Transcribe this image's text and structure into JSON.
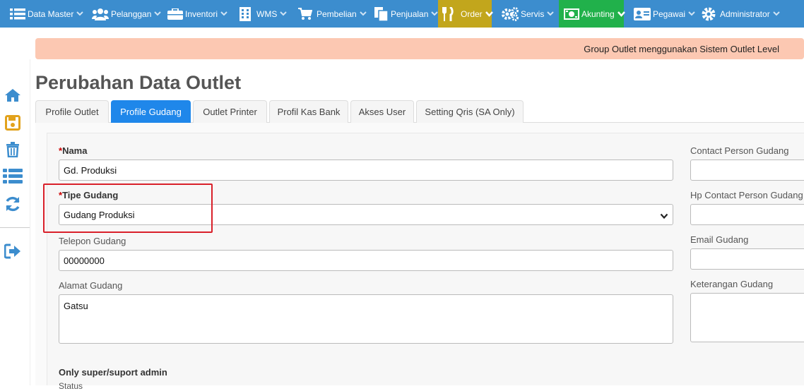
{
  "nav": {
    "items": [
      {
        "label": "Data Master",
        "icon": "list-icon"
      },
      {
        "label": "Pelanggan",
        "icon": "users-icon"
      },
      {
        "label": "Inventori",
        "icon": "briefcase-icon"
      },
      {
        "label": "WMS",
        "icon": "building-icon"
      },
      {
        "label": "Pembelian",
        "icon": "cart-icon"
      },
      {
        "label": "Penjualan",
        "icon": "documents-icon"
      },
      {
        "label": "Order",
        "icon": "utensils-icon"
      },
      {
        "label": "Servis",
        "icon": "gears-icon"
      },
      {
        "label": "Akunting",
        "icon": "money-icon"
      },
      {
        "label": "Pegawai",
        "icon": "id-card-icon"
      },
      {
        "label": "Administrator",
        "icon": "cog-icon"
      }
    ],
    "colors": {
      "bar": "#3c8dce",
      "order": "#c2a61c",
      "akunting": "#21b14b"
    }
  },
  "notice": {
    "text": "Group Outlet menggunakan Sistem Outlet Level"
  },
  "sidebar": {
    "icons": [
      "home-icon",
      "save-icon",
      "trash-icon",
      "list-icon",
      "refresh-icon",
      "logout-icon"
    ]
  },
  "page": {
    "title": "Perubahan Data Outlet"
  },
  "tabs": [
    {
      "label": "Profile Outlet",
      "active": false
    },
    {
      "label": "Profile Gudang",
      "active": true
    },
    {
      "label": "Outlet Printer",
      "active": false
    },
    {
      "label": "Profil Kas Bank",
      "active": false
    },
    {
      "label": "Akses User",
      "active": false
    },
    {
      "label": "Setting Qris (SA Only)",
      "active": false
    }
  ],
  "form": {
    "nama": {
      "asterisk": "*",
      "label": "Nama",
      "value": "Gd. Produksi"
    },
    "tipe_gudang": {
      "asterisk": "*",
      "label": "Tipe Gudang",
      "value": "Gudang Produksi"
    },
    "telepon": {
      "label": "Telepon Gudang",
      "value": "00000000"
    },
    "alamat": {
      "label": "Alamat Gudang",
      "value": "Gatsu"
    },
    "contact_person": {
      "label": "Contact Person Gudang",
      "value": ""
    },
    "hp_contact": {
      "label": "Hp Contact Person Gudang",
      "value": ""
    },
    "email": {
      "label": "Email Gudang",
      "value": ""
    },
    "keterangan": {
      "label": "Keterangan Gudang",
      "value": ""
    },
    "admin_section": {
      "title": "Only super/suport admin",
      "status_label": "Status"
    }
  }
}
